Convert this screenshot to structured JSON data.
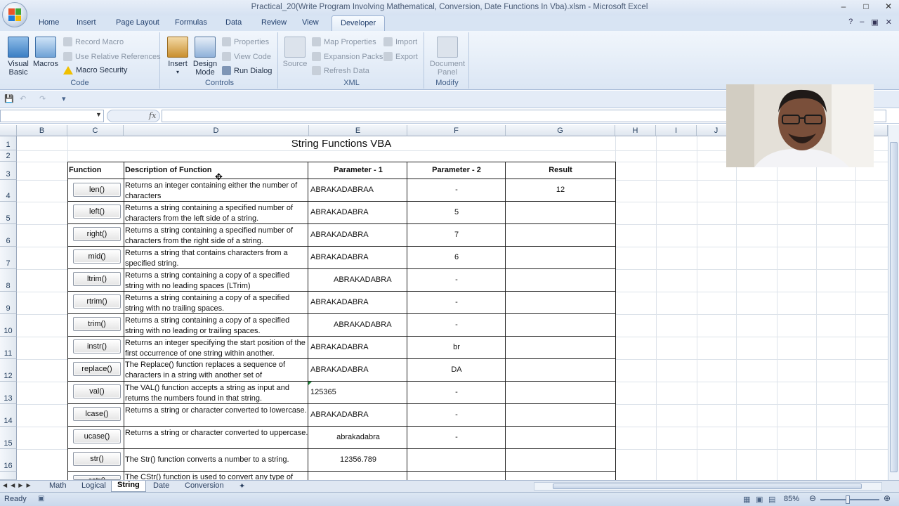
{
  "window": {
    "title": "Practical_20(Write Program Involving Mathematical, Conversion, Date Functions  In Vba).xlsm - Microsoft Excel",
    "minimize": "‒",
    "maximize": "□",
    "close": "✕"
  },
  "ribbon_tabs": [
    "Home",
    "Insert",
    "Page Layout",
    "Formulas",
    "Data",
    "Review",
    "View",
    "Developer"
  ],
  "active_tab": "Developer",
  "ribbon": {
    "code": {
      "label": "Code",
      "visual_basic_line1": "Visual",
      "visual_basic_line2": "Basic",
      "macros": "Macros",
      "record_macro": "Record Macro",
      "use_relative": "Use Relative References",
      "macro_security": "Macro Security"
    },
    "controls": {
      "label": "Controls",
      "insert": "Insert",
      "design_mode_line1": "Design",
      "design_mode_line2": "Mode",
      "properties": "Properties",
      "view_code": "View Code",
      "run_dialog": "Run Dialog"
    },
    "xml": {
      "label": "XML",
      "source": "Source",
      "map_properties": "Map Properties",
      "import": "Import",
      "expansion_packs": "Expansion Packs",
      "export": "Export",
      "refresh_data": "Refresh Data"
    },
    "modify": {
      "label": "Modify",
      "document_panel_line1": "Document",
      "document_panel_line2": "Panel"
    }
  },
  "formula_bar": {
    "fx": "fx",
    "name_box": "",
    "formula": ""
  },
  "columns": [
    "B",
    "C",
    "D",
    "E",
    "F",
    "G",
    "H",
    "I",
    "J",
    "N"
  ],
  "rows": [
    "1",
    "2",
    "3",
    "4",
    "5",
    "6",
    "7",
    "8",
    "9",
    "10",
    "11",
    "12",
    "13",
    "14",
    "15",
    "16"
  ],
  "sheet": {
    "title": "String Functions  VBA",
    "headers": {
      "function": "Function",
      "description": "Description of Function",
      "param1": "Parameter - 1",
      "param2": "Parameter - 2",
      "result": "Result"
    },
    "rows": [
      {
        "btn": "len()",
        "desc": "Returns an integer containing either the number of characters",
        "p1": "ABRAKADABRAA",
        "p2": "-",
        "result": "12"
      },
      {
        "btn": "left()",
        "desc": "Returns a string containing a specified number of characters from the left side of a string.",
        "p1": "ABRAKADABRA",
        "p2": "5",
        "result": ""
      },
      {
        "btn": "right()",
        "desc": "Returns a string containing a specified number of characters from the right side of a string.",
        "p1": "ABRAKADABRA",
        "p2": "7",
        "result": ""
      },
      {
        "btn": "mid()",
        "desc": "Returns a string that contains characters from a specified string.",
        "p1": "ABRAKADABRA",
        "p2": "6",
        "result": ""
      },
      {
        "btn": "ltrim()",
        "desc": "Returns a string containing a copy of a specified string with no leading spaces (LTrim)",
        "p1": "ABRAKADABRA",
        "p2": "-",
        "result": ""
      },
      {
        "btn": "rtrim()",
        "desc": "Returns a string containing a copy of a specified string with no trailing spaces.",
        "p1": "ABRAKADABRA",
        "p2": "-",
        "result": ""
      },
      {
        "btn": "trim()",
        "desc": "Returns a string containing a copy of a specified string with no leading or trailing spaces.",
        "p1": "ABRAKADABRA",
        "p2": "-",
        "result": ""
      },
      {
        "btn": "instr()",
        "desc": "Returns an integer specifying the start position of the first occurrence of one string within another.",
        "p1": "ABRAKADABRA",
        "p2": "br",
        "result": ""
      },
      {
        "btn": "replace()",
        "desc": "The Replace() function replaces a sequence of characters in a string with another set of",
        "p1": "ABRAKADABRA",
        "p2": "DA",
        "result": ""
      },
      {
        "btn": "val()",
        "desc": "The VAL() function accepts a string as input and returns the numbers found in that string.",
        "p1": "125365",
        "p2": "-",
        "result": ""
      },
      {
        "btn": "lcase()",
        "desc": "Returns a string or character converted to lowercase.",
        "p1": "ABRAKADABRA",
        "p2": "-",
        "result": ""
      },
      {
        "btn": "ucase()",
        "desc": "Returns a string or character converted to uppercase.",
        "p1": "abrakadabra",
        "p2": "-",
        "result": ""
      },
      {
        "btn": "str()",
        "desc": "The Str() function converts a number to a string.",
        "p1": "12356.789",
        "p2": "",
        "result": ""
      }
    ],
    "partial_row": {
      "btn": "cstr()",
      "desc": "The CStr() function is used to convert any type of"
    }
  },
  "sheet_tabs": [
    "Math",
    "Logical",
    "String",
    "Date",
    "Conversion"
  ],
  "active_sheet": "String",
  "status": {
    "ready": "Ready",
    "zoom": "85%"
  }
}
